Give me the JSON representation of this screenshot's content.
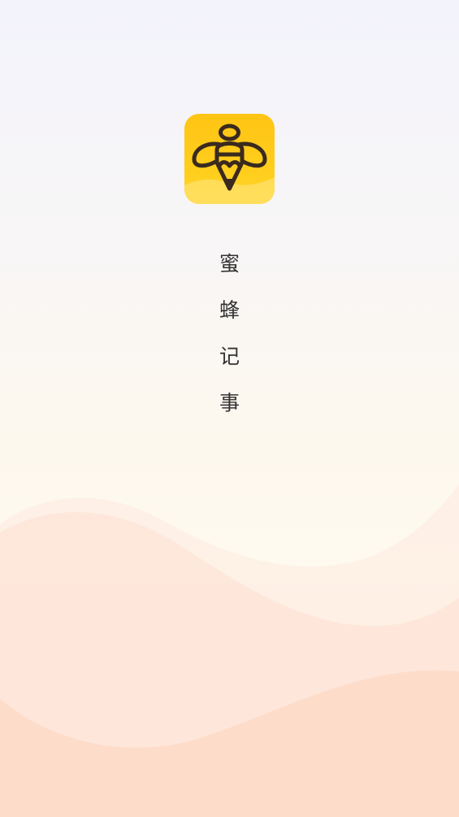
{
  "app": {
    "name_chars": [
      "蜜",
      "蜂",
      "记",
      "事"
    ],
    "icon": "bee-pencil-icon"
  },
  "colors": {
    "icon_yellow": "#ffc414",
    "icon_dark": "#3a2a1e",
    "text": "#333333",
    "wave_light": "#fde8dc",
    "wave_mid": "#fcdcc9"
  }
}
